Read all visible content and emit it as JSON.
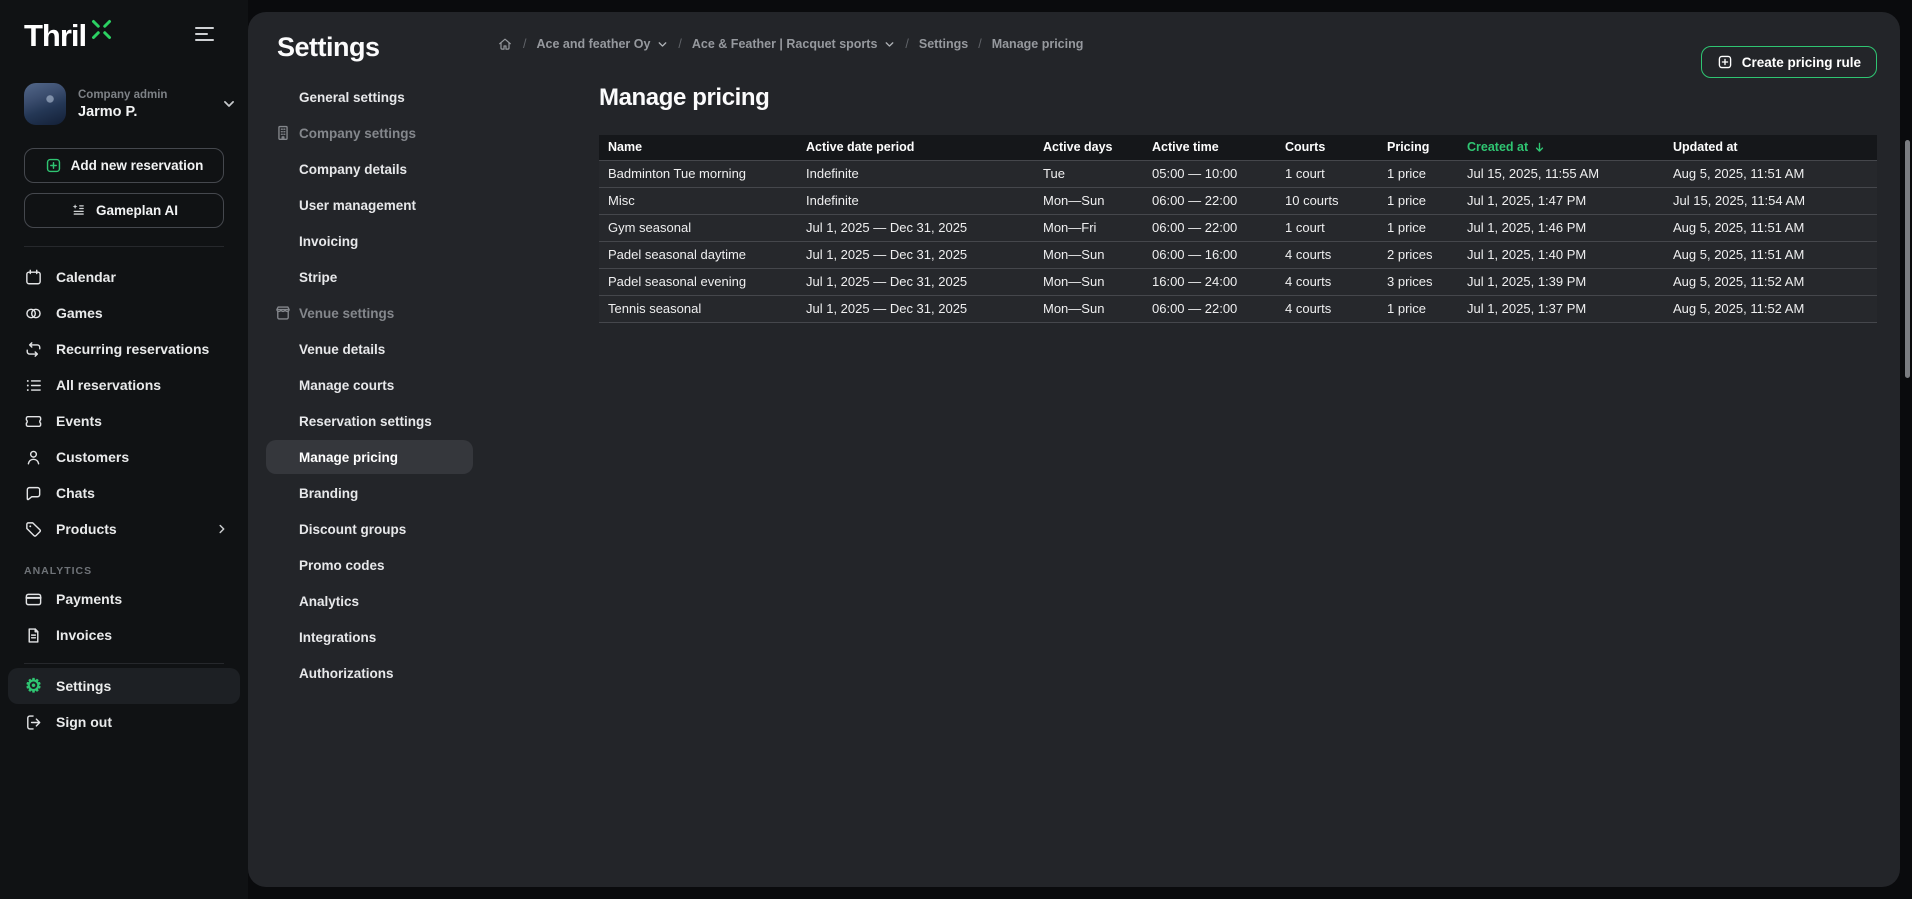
{
  "app": {
    "name": "Thril",
    "accent_green": "#2fc572",
    "logo_green": "#2bd162"
  },
  "sidebar": {
    "user": {
      "role": "Company admin",
      "name": "Jarmo P."
    },
    "add_reservation_label": "Add new reservation",
    "gameplan_label": "Gameplan AI",
    "nav": [
      {
        "label": "Calendar"
      },
      {
        "label": "Games"
      },
      {
        "label": "Recurring reservations"
      },
      {
        "label": "All reservations"
      },
      {
        "label": "Events"
      },
      {
        "label": "Customers"
      },
      {
        "label": "Chats"
      },
      {
        "label": "Products"
      }
    ],
    "section_label": "ANALYTICS",
    "analytics_nav": [
      {
        "label": "Payments"
      },
      {
        "label": "Invoices"
      }
    ],
    "settings_label": "Settings",
    "signout_label": "Sign out"
  },
  "settings_nav": {
    "title": "Settings",
    "items": [
      {
        "label": "General settings",
        "type": "link"
      },
      {
        "label": "Company settings",
        "type": "group",
        "icon": "company-icon"
      },
      {
        "label": "Company details",
        "type": "link"
      },
      {
        "label": "User management",
        "type": "link"
      },
      {
        "label": "Invoicing",
        "type": "link"
      },
      {
        "label": "Stripe",
        "type": "link"
      },
      {
        "label": "Venue settings",
        "type": "group",
        "icon": "venue-icon"
      },
      {
        "label": "Venue details",
        "type": "link"
      },
      {
        "label": "Manage courts",
        "type": "link"
      },
      {
        "label": "Reservation settings",
        "type": "link"
      },
      {
        "label": "Manage pricing",
        "type": "link",
        "active": true
      },
      {
        "label": "Branding",
        "type": "link"
      },
      {
        "label": "Discount groups",
        "type": "link"
      },
      {
        "label": "Promo codes",
        "type": "link"
      },
      {
        "label": "Analytics",
        "type": "link"
      },
      {
        "label": "Integrations",
        "type": "link"
      },
      {
        "label": "Authorizations",
        "type": "link"
      }
    ]
  },
  "breadcrumb": {
    "items": [
      {
        "label": "Ace and feather Oy",
        "dropdown": true
      },
      {
        "label": "Ace & Feather | Racquet sports",
        "dropdown": true
      },
      {
        "label": "Settings"
      },
      {
        "label": "Manage pricing"
      }
    ]
  },
  "page": {
    "title": "Manage pricing",
    "create_button_label": "Create pricing rule"
  },
  "table": {
    "columns": [
      {
        "key": "name",
        "label": "Name"
      },
      {
        "key": "period",
        "label": "Active date period"
      },
      {
        "key": "days",
        "label": "Active days"
      },
      {
        "key": "time",
        "label": "Active time"
      },
      {
        "key": "courts",
        "label": "Courts"
      },
      {
        "key": "pricing",
        "label": "Pricing"
      },
      {
        "key": "created",
        "label": "Created at",
        "sorted": "desc"
      },
      {
        "key": "updated",
        "label": "Updated at"
      }
    ],
    "rows": [
      {
        "name": "Badminton Tue morning",
        "period": "Indefinite",
        "days": "Tue",
        "time": "05:00 — 10:00",
        "courts": "1 court",
        "pricing": "1 price",
        "created": "Jul 15, 2025, 11:55 AM",
        "updated": "Aug 5, 2025, 11:51 AM"
      },
      {
        "name": "Misc",
        "period": "Indefinite",
        "days": "Mon—Sun",
        "time": "06:00 — 22:00",
        "courts": "10 courts",
        "pricing": "1 price",
        "created": "Jul 1, 2025, 1:47 PM",
        "updated": "Jul 15, 2025, 11:54 AM"
      },
      {
        "name": "Gym seasonal",
        "period": "Jul 1, 2025 — Dec 31, 2025",
        "days": "Mon—Fri",
        "time": "06:00 — 22:00",
        "courts": "1 court",
        "pricing": "1 price",
        "created": "Jul 1, 2025, 1:46 PM",
        "updated": "Aug 5, 2025, 11:51 AM"
      },
      {
        "name": "Padel seasonal daytime",
        "period": "Jul 1, 2025 — Dec 31, 2025",
        "days": "Mon—Sun",
        "time": "06:00 — 16:00",
        "courts": "4 courts",
        "pricing": "2 prices",
        "created": "Jul 1, 2025, 1:40 PM",
        "updated": "Aug 5, 2025, 11:51 AM"
      },
      {
        "name": "Padel seasonal evening",
        "period": "Jul 1, 2025 — Dec 31, 2025",
        "days": "Mon—Sun",
        "time": "16:00 — 24:00",
        "courts": "4 courts",
        "pricing": "3 prices",
        "created": "Jul 1, 2025, 1:39 PM",
        "updated": "Aug 5, 2025, 11:52 AM"
      },
      {
        "name": "Tennis seasonal",
        "period": "Jul 1, 2025 — Dec 31, 2025",
        "days": "Mon—Sun",
        "time": "06:00 — 22:00",
        "courts": "4 courts",
        "pricing": "1 price",
        "created": "Jul 1, 2025, 1:37 PM",
        "updated": "Aug 5, 2025, 11:52 AM"
      }
    ]
  }
}
